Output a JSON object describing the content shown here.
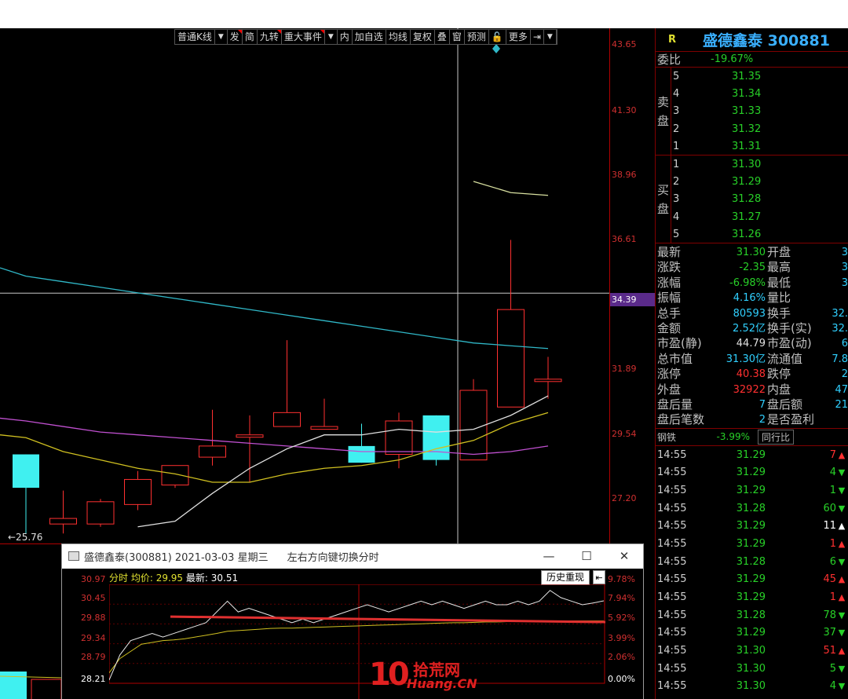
{
  "toolbar": {
    "items": [
      {
        "label": "普通K线",
        "has_dropdown": true
      },
      {
        "label": "发",
        "marked": true
      },
      {
        "label": "简"
      },
      {
        "label": "九转",
        "marked": true
      },
      {
        "label": "重大事件",
        "marked": true,
        "has_dropdown": true
      },
      {
        "label": "内"
      },
      {
        "label": "加自选"
      },
      {
        "label": "均线"
      },
      {
        "label": "复权"
      },
      {
        "label": "叠"
      },
      {
        "label": "窗"
      },
      {
        "label": "预测"
      },
      {
        "label": "🔓"
      },
      {
        "label": "更多"
      },
      {
        "label": "⇥",
        "has_dropdown": true
      }
    ]
  },
  "price_axis": {
    "labels": [
      "43.65",
      "41.30",
      "38.96",
      "36.61",
      "34.39",
      "31.89",
      "29.54",
      "27.20"
    ],
    "current": "34.39"
  },
  "chart_data": [
    {
      "type": "candlestick",
      "ylim": [
        25.4,
        43.9
      ],
      "candles": [
        {
          "o": 28.6,
          "c": 27.4,
          "h": 28.6,
          "l": 25.76
        },
        {
          "o": 26.1,
          "c": 26.3,
          "h": 27.3,
          "l": 25.76
        },
        {
          "o": 26.1,
          "c": 26.9,
          "h": 27.0,
          "l": 26.0
        },
        {
          "o": 26.8,
          "c": 27.7,
          "h": 28.0,
          "l": 26.6
        },
        {
          "o": 27.5,
          "c": 28.2,
          "h": 28.2,
          "l": 27.4
        },
        {
          "o": 28.5,
          "c": 28.9,
          "h": 30.2,
          "l": 28.2
        },
        {
          "o": 29.3,
          "c": 29.3,
          "h": 30.0,
          "l": 27.6
        },
        {
          "o": 29.6,
          "c": 30.1,
          "h": 32.7,
          "l": 29.6
        },
        {
          "o": 29.5,
          "c": 29.6,
          "h": 30.6,
          "l": 29.5
        },
        {
          "o": 28.9,
          "c": 28.3,
          "h": 29.7,
          "l": 28.3
        },
        {
          "o": 28.6,
          "c": 29.8,
          "h": 30.1,
          "l": 28.1
        },
        {
          "o": 30.0,
          "c": 28.4,
          "h": 30.0,
          "l": 28.2
        },
        {
          "o": 28.4,
          "c": 30.9,
          "h": 31.3,
          "l": 28.4
        },
        {
          "o": 30.3,
          "c": 33.8,
          "h": 36.3,
          "l": 30.3
        },
        {
          "o": 31.3,
          "c": 31.3,
          "h": 32.1,
          "l": 30.6
        }
      ],
      "ma_white": [
        null,
        null,
        null,
        26.0,
        26.2,
        27.2,
        28.1,
        28.8,
        29.3,
        29.3,
        29.5,
        29.4,
        29.5,
        30.0,
        30.7
      ],
      "ma_yellow": [
        29.2,
        28.7,
        28.4,
        28.1,
        27.9,
        27.6,
        27.6,
        27.9,
        28.1,
        28.2,
        28.4,
        28.8,
        29.1,
        29.7,
        30.1
      ],
      "ma_purple": [
        29.8,
        29.6,
        29.4,
        29.3,
        29.2,
        29.1,
        29.0,
        28.9,
        28.8,
        28.7,
        28.7,
        28.7,
        28.6,
        28.7,
        28.9
      ],
      "ma_cyan": [
        35.0,
        34.8,
        34.6,
        34.4,
        34.2,
        34.0,
        33.8,
        33.6,
        33.4,
        33.2,
        33.0,
        32.8,
        32.6,
        32.5,
        32.4
      ],
      "ma_olive": [
        null,
        null,
        null,
        null,
        null,
        null,
        null,
        null,
        null,
        null,
        null,
        null,
        38.4,
        38.0,
        37.9
      ],
      "low_marker": "←25.76",
      "crosshair_price": 34.39
    },
    {
      "type": "line",
      "ylim": [
        28.21,
        30.97
      ],
      "left_ticks": [
        "30.97",
        "30.45",
        "29.88",
        "29.34",
        "28.79",
        "28.21"
      ],
      "right_ticks": [
        "9.78%",
        "7.94%",
        "5.92%",
        "3.99%",
        "2.06%",
        "0.00%"
      ],
      "price": [
        28.3,
        29.0,
        29.4,
        29.5,
        29.6,
        29.5,
        29.6,
        29.7,
        29.8,
        29.9,
        30.2,
        30.5,
        30.2,
        30.3,
        30.2,
        30.1,
        30.0,
        29.9,
        30.0,
        29.9,
        30.0,
        30.1,
        30.2,
        30.3,
        30.4,
        30.3,
        30.2,
        30.3,
        30.4,
        30.5,
        30.4,
        30.5,
        30.4,
        30.3,
        30.4,
        30.5,
        30.4,
        30.4,
        30.5,
        30.4,
        30.5,
        30.8,
        30.6,
        30.5,
        30.4,
        30.45,
        30.51
      ],
      "avg": [
        28.5,
        28.9,
        29.1,
        29.3,
        29.35,
        29.4,
        29.42,
        29.45,
        29.5,
        29.55,
        29.6,
        29.66,
        29.68,
        29.7,
        29.72,
        29.74,
        29.75,
        29.75,
        29.76,
        29.77,
        29.78,
        29.79,
        29.8,
        29.81,
        29.82,
        29.83,
        29.84,
        29.85,
        29.86,
        29.87,
        29.88,
        29.89,
        29.9,
        29.9,
        29.91,
        29.92,
        29.92,
        29.93,
        29.93,
        29.94,
        29.94,
        29.95,
        29.95,
        29.95,
        29.95,
        29.95,
        29.95
      ]
    }
  ],
  "stock": {
    "flag": "R",
    "name_code": "盛德鑫泰 300881"
  },
  "weibi": {
    "label": "委比",
    "value": "-19.67%"
  },
  "sell_book": {
    "tag": [
      "卖",
      "盘"
    ],
    "rows": [
      {
        "lv": "5",
        "px": "31.35"
      },
      {
        "lv": "4",
        "px": "31.34"
      },
      {
        "lv": "3",
        "px": "31.33"
      },
      {
        "lv": "2",
        "px": "31.32"
      },
      {
        "lv": "1",
        "px": "31.31"
      }
    ]
  },
  "buy_book": {
    "tag": [
      "买",
      "盘"
    ],
    "rows": [
      {
        "lv": "1",
        "px": "31.30"
      },
      {
        "lv": "2",
        "px": "31.29"
      },
      {
        "lv": "3",
        "px": "31.28"
      },
      {
        "lv": "4",
        "px": "31.27"
      },
      {
        "lv": "5",
        "px": "31.26"
      }
    ]
  },
  "quote": [
    {
      "k1": "最新",
      "v1": "31.30",
      "c1": "green",
      "k2": "开盘",
      "v2": "3"
    },
    {
      "k1": "涨跌",
      "v1": "-2.35",
      "c1": "green",
      "k2": "最高",
      "v2": "3"
    },
    {
      "k1": "涨幅",
      "v1": "-6.98%",
      "c1": "green",
      "k2": "最低",
      "v2": "3"
    },
    {
      "k1": "振幅",
      "v1": "4.16%",
      "c1": "cyan",
      "k2": "量比",
      "v2": ""
    },
    {
      "k1": "总手",
      "v1": "80593",
      "c1": "cyan",
      "k2": "换手",
      "v2": "32."
    },
    {
      "k1": "金额",
      "v1": "2.52亿",
      "c1": "cyan",
      "k2": "换手(实)",
      "v2": "32."
    },
    {
      "k1": "市盈(静)",
      "v1": "44.79",
      "c1": "white",
      "k2": "市盈(动)",
      "v2": "6"
    },
    {
      "k1": "总市值",
      "v1": "31.30亿",
      "c1": "cyan",
      "k2": "流通值",
      "v2": "7.8"
    },
    {
      "k1": "涨停",
      "v1": "40.38",
      "c1": "red",
      "k2": "跌停",
      "v2": "2"
    },
    {
      "k1": "外盘",
      "v1": "32922",
      "c1": "red",
      "k2": "内盘",
      "v2": "47"
    },
    {
      "k1": "盘后量",
      "v1": "7",
      "c1": "cyan",
      "k2": "盘后额",
      "v2": "21"
    },
    {
      "k1": "盘后笔数",
      "v1": "2",
      "c1": "cyan",
      "k2": "是否盈利",
      "v2": ""
    }
  ],
  "sector": {
    "name": "钢铁",
    "pct": "-3.99%",
    "button": "同行比"
  },
  "ticks": [
    {
      "t": "14:55",
      "p": "31.29",
      "v": "7",
      "dir": "up"
    },
    {
      "t": "14:55",
      "p": "31.29",
      "v": "4",
      "dir": "down"
    },
    {
      "t": "14:55",
      "p": "31.29",
      "v": "1",
      "dir": "down"
    },
    {
      "t": "14:55",
      "p": "31.28",
      "v": "60",
      "dir": "down"
    },
    {
      "t": "14:55",
      "p": "31.29",
      "v": "11",
      "dir": "neutral"
    },
    {
      "t": "14:55",
      "p": "31.29",
      "v": "1",
      "dir": "up"
    },
    {
      "t": "14:55",
      "p": "31.28",
      "v": "6",
      "dir": "down"
    },
    {
      "t": "14:55",
      "p": "31.29",
      "v": "45",
      "dir": "up"
    },
    {
      "t": "14:55",
      "p": "31.29",
      "v": "1",
      "dir": "up"
    },
    {
      "t": "14:55",
      "p": "31.28",
      "v": "78",
      "dir": "down"
    },
    {
      "t": "14:55",
      "p": "31.29",
      "v": "37",
      "dir": "down"
    },
    {
      "t": "14:55",
      "p": "31.30",
      "v": "51",
      "dir": "up"
    },
    {
      "t": "14:55",
      "p": "31.30",
      "v": "5",
      "dir": "down"
    },
    {
      "t": "14:55",
      "p": "31.30",
      "v": "4",
      "dir": "down"
    }
  ],
  "popup": {
    "title": "盛德鑫泰(300881) 2021-03-03 星期三",
    "hint": "左右方向键切换分时",
    "minimize": "—",
    "maximize": "☐",
    "close": "✕",
    "head_label": "分时 均价: ",
    "avg_price": "29.95",
    "latest_label": "最新: ",
    "latest_price": "30.51",
    "history_btn": "历史重现",
    "history_icon": "⇤"
  },
  "watermark": {
    "num": "10",
    "cn": "拾荒网",
    "en": "Huang.CN"
  },
  "colors": {
    "up": "#ff3030",
    "down": "#40f0f0",
    "grid": "#b00000",
    "ma_white": "#e0e0e0",
    "ma_yellow": "#d0c020",
    "ma_purple": "#c050d0",
    "ma_cyan": "#30b8c8"
  }
}
